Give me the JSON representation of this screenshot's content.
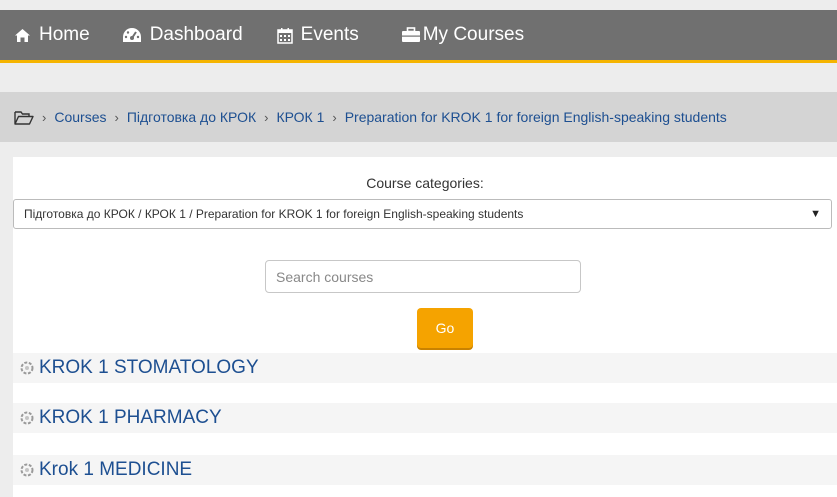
{
  "navbar": {
    "items": [
      {
        "label": "Home",
        "icon": "home-icon"
      },
      {
        "label": "Dashboard",
        "icon": "dashboard-icon"
      },
      {
        "label": "Events",
        "icon": "calendar-icon"
      },
      {
        "label": "My Courses",
        "icon": "briefcase-icon"
      }
    ],
    "accent": "#f5b400"
  },
  "breadcrumb": {
    "icon": "folder-open-icon",
    "items": [
      "Courses",
      "Підготовка до КРОК",
      "КРОК 1",
      "Preparation for KROK 1 for foreign English-speaking students"
    ]
  },
  "category_filter": {
    "label": "Course categories:",
    "selected": "Підготовка до КРОК / КРОК 1 / Preparation for KROK 1 for foreign English-speaking students"
  },
  "search": {
    "placeholder": "Search courses",
    "value": "",
    "button_label": "Go"
  },
  "courses": [
    {
      "name": "KROK 1 STOMATOLOGY",
      "icon": "course-icon"
    },
    {
      "name": "KROK 1 PHARMACY",
      "icon": "course-icon"
    },
    {
      "name": "Krok 1 MEDICINE",
      "icon": "course-icon"
    }
  ],
  "colors": {
    "navbar_bg": "#707070",
    "link": "#1d4f91",
    "button": "#f5a300"
  }
}
